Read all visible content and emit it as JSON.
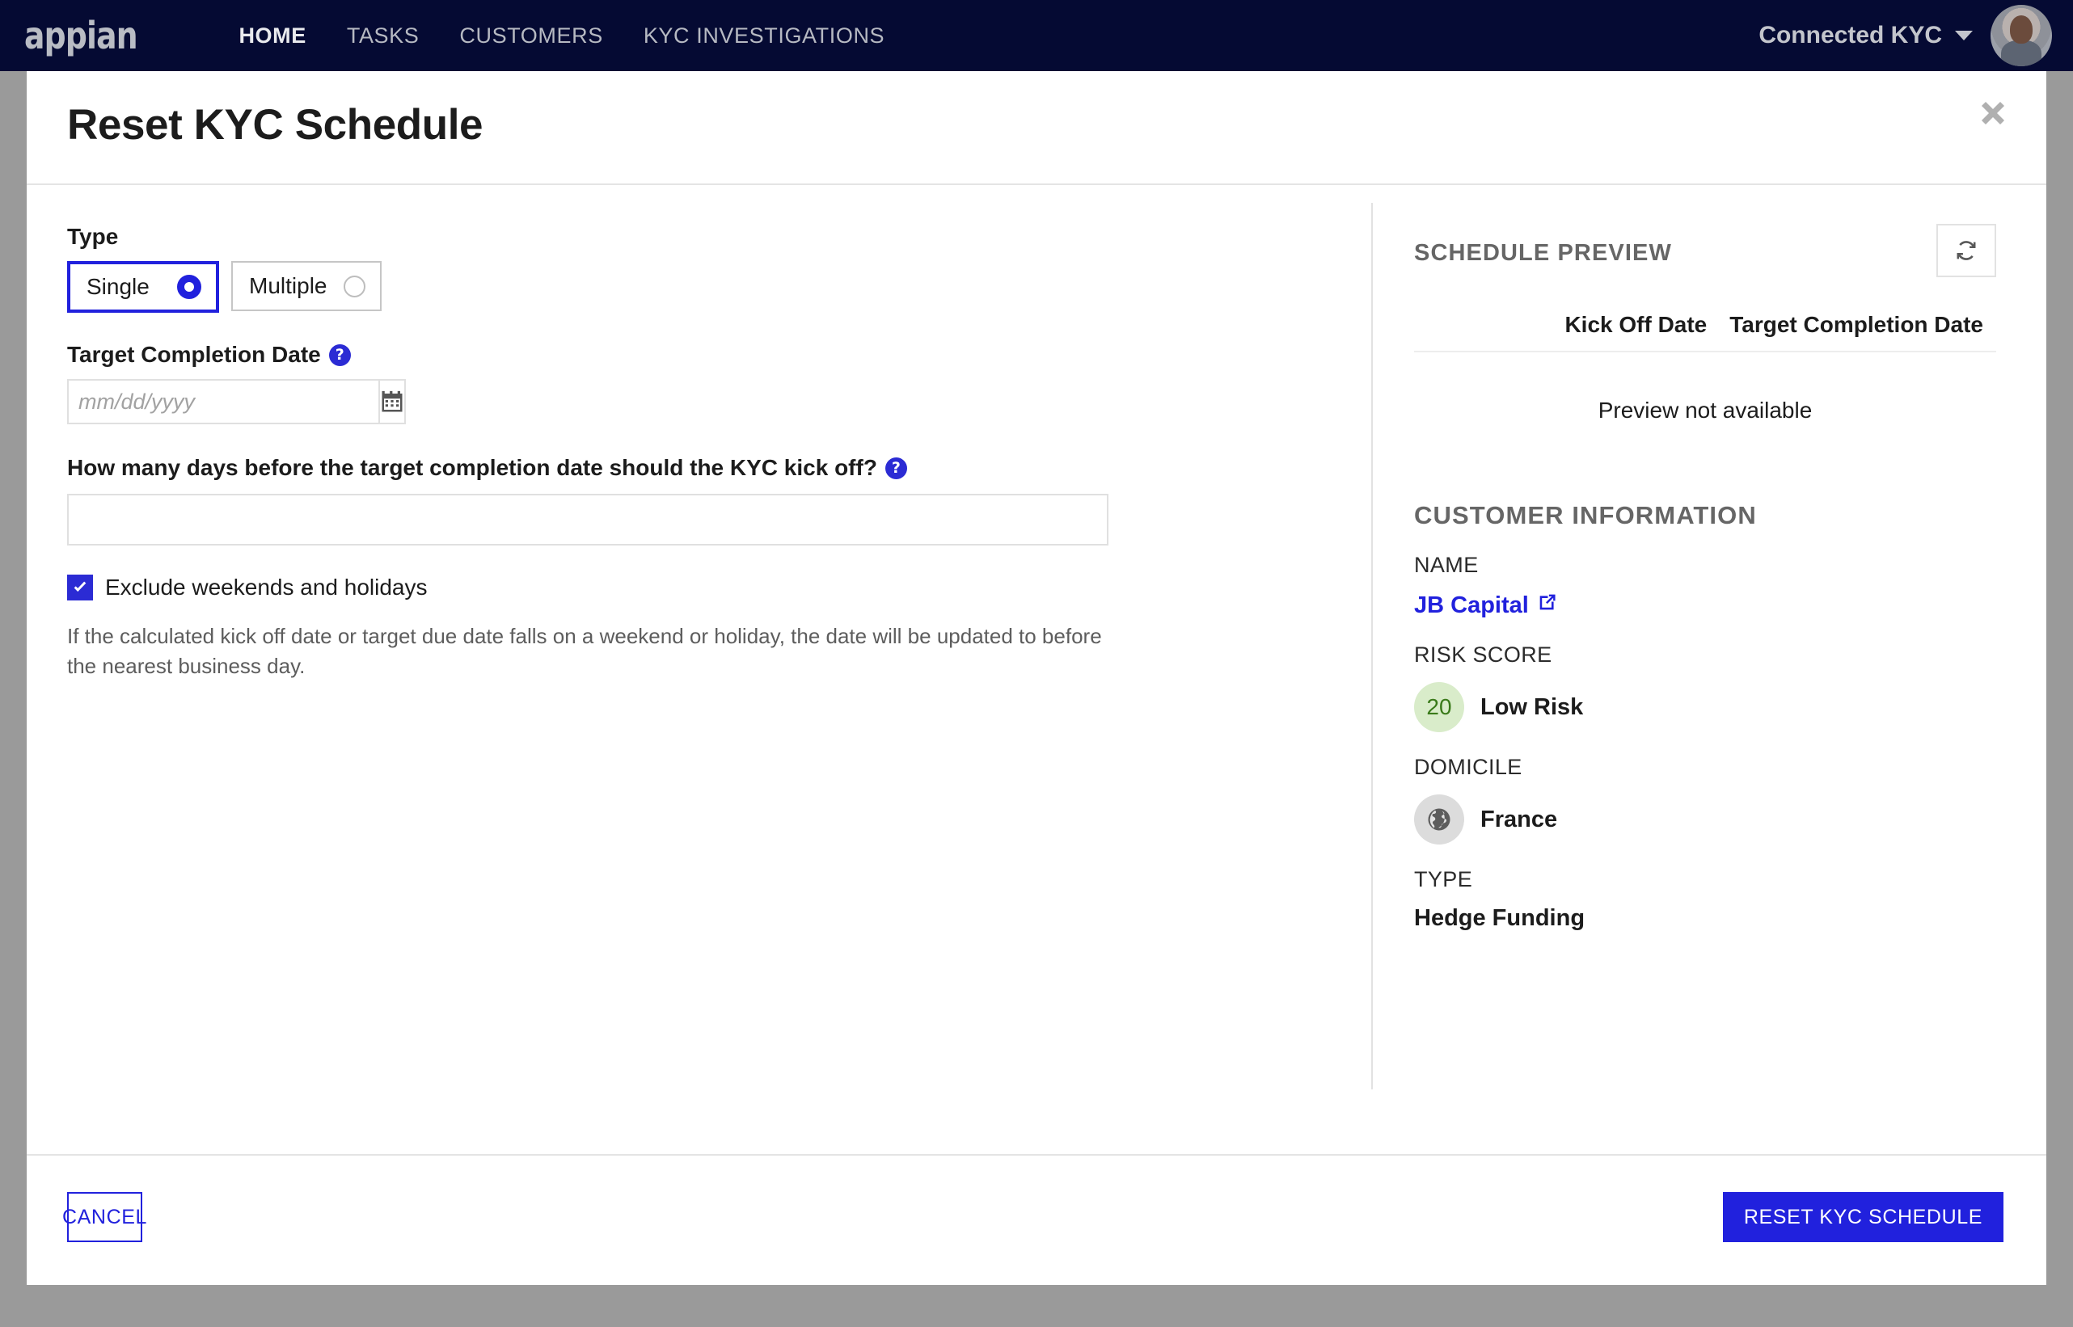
{
  "navbar": {
    "brand": "appian",
    "links": [
      {
        "label": "HOME",
        "active": true
      },
      {
        "label": "TASKS",
        "active": false
      },
      {
        "label": "CUSTOMERS",
        "active": false
      },
      {
        "label": "KYC INVESTIGATIONS",
        "active": false
      }
    ],
    "user_menu_label": "Connected KYC",
    "caret_icon": "chevron-down-icon",
    "avatar_icon": "user-avatar"
  },
  "modal": {
    "title": "Reset KYC Schedule",
    "close_icon": "close-icon"
  },
  "form": {
    "type_label": "Type",
    "type_options": [
      {
        "label": "Single",
        "selected": true
      },
      {
        "label": "Multiple",
        "selected": false
      }
    ],
    "target_date_label": "Target Completion Date",
    "target_date_help_icon": "help-circle-icon",
    "target_date_value": "",
    "target_date_placeholder": "mm/dd/yyyy",
    "calendar_icon": "calendar-icon",
    "days_question_label": "How many days before the target completion date should the KYC kick off?",
    "days_question_help_icon": "help-circle-icon",
    "days_value": "",
    "days_placeholder": "",
    "exclude_checkbox_label": "Exclude weekends and holidays",
    "exclude_checkbox_checked": true,
    "check_icon": "checkmark-icon",
    "help_text": "If the calculated kick off date or target due date falls on a weekend or holiday, the date will be updated to before the nearest business day."
  },
  "preview": {
    "section_title": "SCHEDULE PREVIEW",
    "refresh_icon": "refresh-icon",
    "columns": [
      "Kick Off Date",
      "Target Completion Date"
    ],
    "empty_message": "Preview not available"
  },
  "customer": {
    "section_title": "CUSTOMER INFORMATION",
    "name_label": "NAME",
    "name_value": "JB Capital",
    "name_link_icon": "external-link-icon",
    "risk_label": "RISK SCORE",
    "risk_score": "20",
    "risk_text": "Low Risk",
    "risk_color": "#d9ecca",
    "risk_text_color": "#3a7a1a",
    "domicile_label": "DOMICILE",
    "domicile_value": "France",
    "globe_icon": "globe-icon",
    "type_label": "TYPE",
    "type_value": "Hedge Funding"
  },
  "footer": {
    "cancel_label": "CANCEL",
    "submit_label": "RESET KYC SCHEDULE"
  },
  "colors": {
    "nav_bg": "#050a33",
    "accent": "#2121dd",
    "backdrop": "#9a9a9a"
  }
}
